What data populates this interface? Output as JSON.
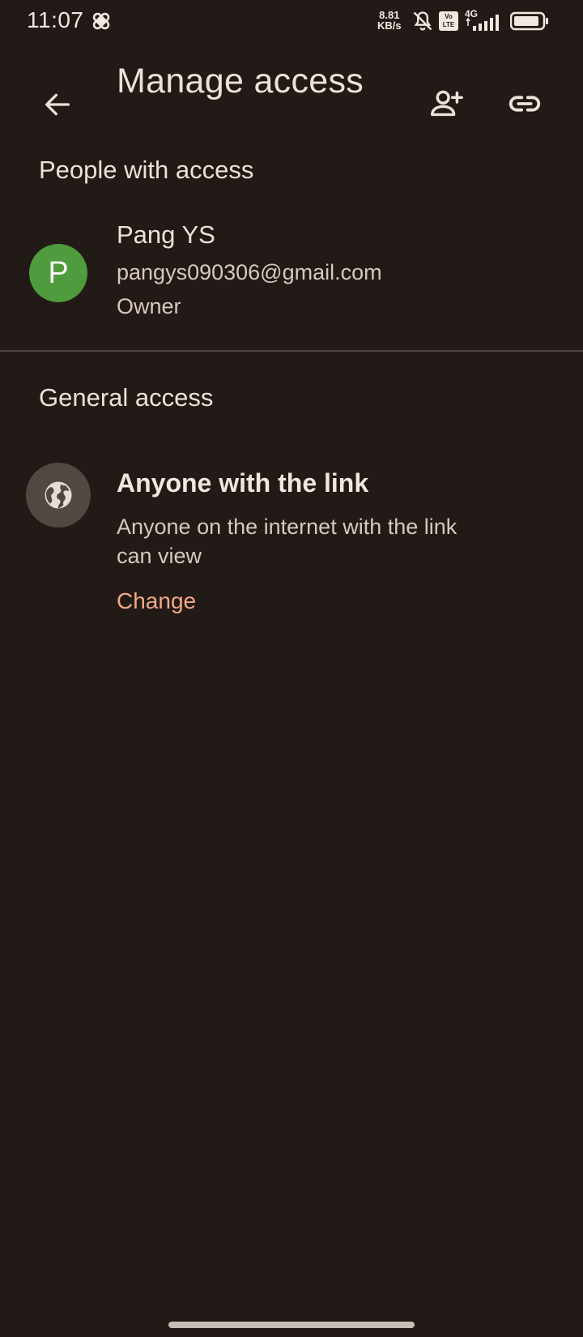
{
  "status_bar": {
    "time": "11:07",
    "net_speed_value": "8.81",
    "net_speed_unit": "KB/s",
    "volte_label": "Vo LTE",
    "network_type": "4G",
    "icons": [
      "bandage-icon",
      "bell-off-icon",
      "volte-icon",
      "signal-icon",
      "battery-icon"
    ]
  },
  "app_bar": {
    "title": "Manage access",
    "back_icon": "arrow-back-icon",
    "add_person_icon": "person-add-icon",
    "link_icon": "link-icon"
  },
  "people_section": {
    "heading": "People with access",
    "people": [
      {
        "avatar_letter": "P",
        "avatar_color": "#4f9b3d",
        "name": "Pang YS",
        "email": "pangys090306@gmail.com",
        "role": "Owner"
      }
    ]
  },
  "general_access": {
    "heading": "General access",
    "icon": "globe-icon",
    "title": "Anyone with the link",
    "description": "Anyone on the internet with the link can view",
    "change_label": "Change"
  },
  "colors": {
    "background": "#211a16",
    "text_primary": "#efe1d8",
    "text_secondary": "#d8c8be",
    "accent": "#f4a887",
    "divider": "#4f4540"
  }
}
